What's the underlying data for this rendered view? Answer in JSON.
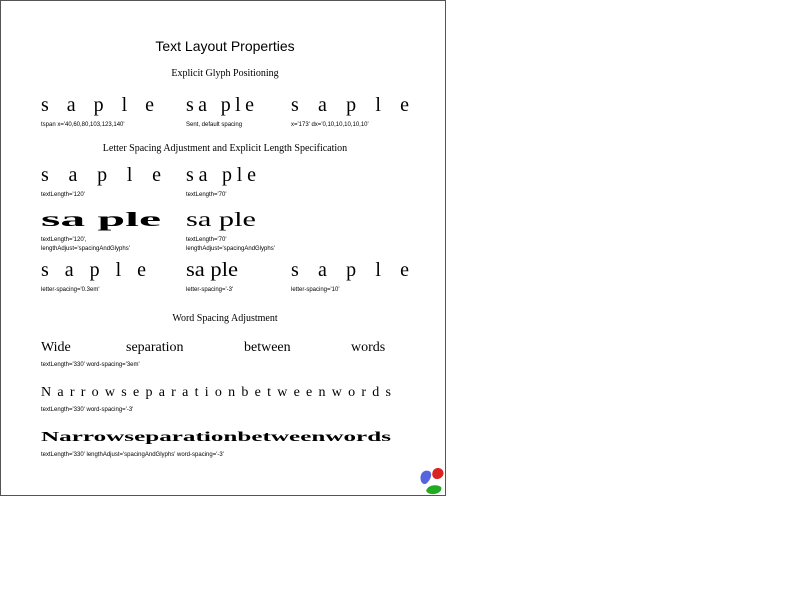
{
  "title": "Text Layout Properties",
  "sections": {
    "glyph_positioning": {
      "heading": "Explicit Glyph Positioning",
      "samples": [
        {
          "glyphs": "s a p l e",
          "caption": "tspan x='40,60,80,103,123,140'"
        },
        {
          "glyphs": "sa ple",
          "caption": "Sent, default spacing"
        },
        {
          "glyphs": "s a p l e",
          "caption": "x='173' dx='0,10,10,10,10,10'"
        }
      ]
    },
    "letter_spacing": {
      "heading": "Letter Spacing Adjustment and Explicit Length Specification",
      "row1": [
        {
          "glyphs": "s a p l e",
          "caption": "textLength='120'"
        },
        {
          "glyphs": "sa ple",
          "caption": "textLength='70'"
        }
      ],
      "row2": [
        {
          "glyphs": "sa ple",
          "caption_line1": "textLength='120',",
          "caption_line2": "lengthAdjust='spacingAndGlyphs'"
        },
        {
          "glyphs": "sa ple",
          "caption_line1": "textLength='70'",
          "caption_line2": "lengthAdjust='spacingAndGlyphs'"
        }
      ],
      "row3": [
        {
          "glyphs": "s a p l e",
          "caption": "letter-spacing='0.3em'"
        },
        {
          "glyphs": "sa ple",
          "caption": "letter-spacing='-3'"
        },
        {
          "glyphs": "s a p l e",
          "caption": "letter-spacing='10'"
        }
      ]
    },
    "word_spacing": {
      "heading": "Word Spacing Adjustment",
      "lines": [
        {
          "words": [
            "Wide",
            "separation",
            "between",
            "words"
          ],
          "caption": "textLength='330' word-spacing='3em'"
        },
        {
          "text": "N a r r o w s e p a r a t i o n b e t w e e n w o r d s",
          "caption": "textLength='330' word-spacing='-3'"
        },
        {
          "text": "Narrowseparationbetweenwords",
          "caption": "textLength='330' lengthAdjust='spacingAndGlyphs' word-spacing='-3'"
        }
      ]
    }
  },
  "logo": {
    "name": "svg-logo-icon",
    "colors": [
      "#5566dd",
      "#dd2222",
      "#22aa22"
    ]
  }
}
